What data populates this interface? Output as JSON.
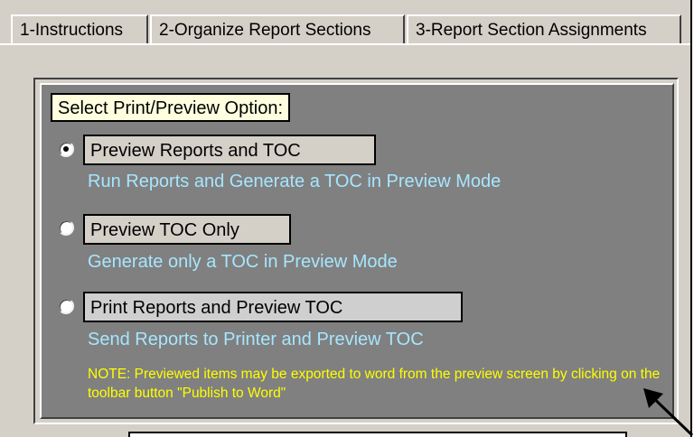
{
  "tabs": [
    {
      "label": "1-Instructions"
    },
    {
      "label": "2-Organize Report Sections"
    },
    {
      "label": "3-Report Section Assignments"
    }
  ],
  "panel": {
    "title": "Select Print/Preview Option:",
    "options": [
      {
        "label": "Preview Reports and TOC",
        "description": "Run Reports and Generate a TOC in Preview Mode",
        "selected": true
      },
      {
        "label": "Preview TOC Only",
        "description": "Generate only a TOC in Preview Mode",
        "selected": false
      },
      {
        "label": "Print Reports and  Preview TOC",
        "description": "Send Reports to Printer and Preview TOC",
        "selected": false
      }
    ],
    "note": "NOTE: Previewed items may be exported to word from the preview screen by clicking on the toolbar button \"Publish to Word\""
  },
  "colors": {
    "panel_bg": "#808080",
    "description_text": "#a6e6ff",
    "note_text": "#ffff00",
    "title_bg": "#ffffe0"
  }
}
